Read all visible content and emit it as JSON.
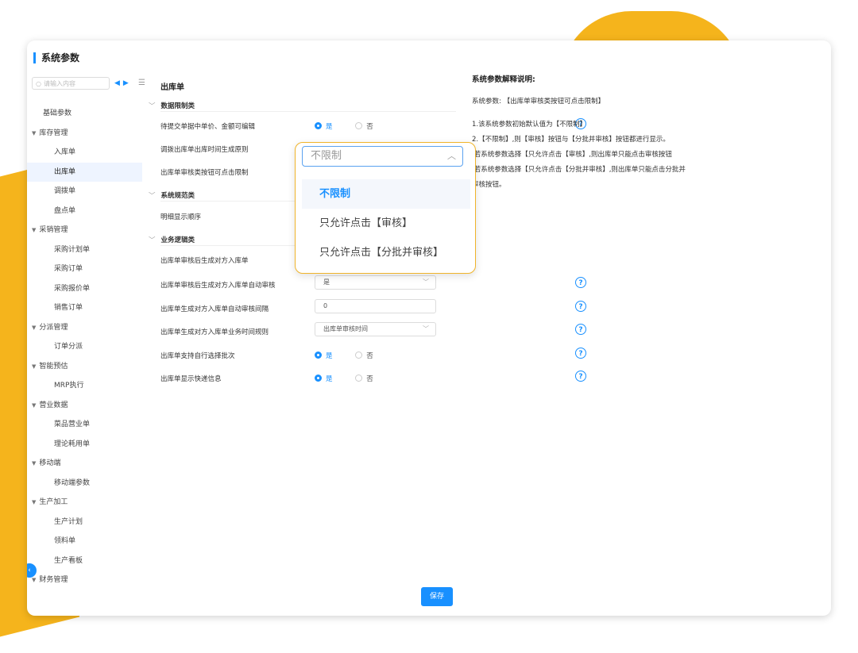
{
  "page": {
    "title": "系统参数"
  },
  "search": {
    "placeholder": "请输入内容"
  },
  "sidebar": [
    {
      "label": "基础参数",
      "type": "top"
    },
    {
      "label": "库存管理",
      "type": "group"
    },
    {
      "label": "入库单",
      "type": "child"
    },
    {
      "label": "出库单",
      "type": "child",
      "active": true
    },
    {
      "label": "调拨单",
      "type": "child"
    },
    {
      "label": "盘点单",
      "type": "child"
    },
    {
      "label": "采销管理",
      "type": "group"
    },
    {
      "label": "采购计划单",
      "type": "child"
    },
    {
      "label": "采购订单",
      "type": "child"
    },
    {
      "label": "采购报价单",
      "type": "child"
    },
    {
      "label": "销售订单",
      "type": "child"
    },
    {
      "label": "分派管理",
      "type": "group"
    },
    {
      "label": "订单分派",
      "type": "child"
    },
    {
      "label": "智能预估",
      "type": "group"
    },
    {
      "label": "MRP执行",
      "type": "child"
    },
    {
      "label": "营业数据",
      "type": "group"
    },
    {
      "label": "菜品营业单",
      "type": "child"
    },
    {
      "label": "理论耗用单",
      "type": "child"
    },
    {
      "label": "移动端",
      "type": "group"
    },
    {
      "label": "移动端参数",
      "type": "child"
    },
    {
      "label": "生产加工",
      "type": "group"
    },
    {
      "label": "生产计划",
      "type": "child"
    },
    {
      "label": "领料单",
      "type": "child"
    },
    {
      "label": "生产看板",
      "type": "child"
    },
    {
      "label": "财务管理",
      "type": "group"
    }
  ],
  "main": {
    "section_title": "出库单",
    "categories": {
      "data_limit": "数据限制类",
      "system_norm": "系统规范类",
      "business_logic": "业务逻辑类"
    },
    "rows": {
      "r1": {
        "label": "待提交单据中单价、金额可编辑",
        "yes": "是",
        "no": "否"
      },
      "r2": {
        "label": "调拨出库单出库时间生成原则"
      },
      "r3": {
        "label": "出库单审核类按钮可点击限制"
      },
      "r4": {
        "label": "明细显示顺序"
      },
      "r5": {
        "label": "出库单审核后生成对方入库单"
      },
      "r6": {
        "label": "出库单审核后生成对方入库单自动审核",
        "value": "是"
      },
      "r7": {
        "label": "出库单生成对方入库单自动审核间隔",
        "value": "0"
      },
      "r8": {
        "label": "出库单生成对方入库单业务时间规则",
        "value": "出库单审核时间"
      },
      "r9": {
        "label": "出库单支持自行选择批次",
        "yes": "是",
        "no": "否"
      },
      "r10": {
        "label": "出库单显示快递信息",
        "yes": "是",
        "no": "否"
      }
    },
    "help_glyph": "?",
    "save_label": "保存"
  },
  "explain": {
    "title": "系统参数解释说明:",
    "param": "系统参数: 【出库单审核类按钮可点击限制】",
    "lines": [
      "1.该系统参数初始默认值为【不限制】",
      "2.【不限制】,则【审核】按钮与【分批并审核】按钮都进行显示。",
      ".若系统参数选择【只允许点击【审核】,则出库单只能点击审核按钮",
      ".若系统参数选择【只允许点击【分批并审核】,则出库单只能点击分批并",
      "审核按钮。"
    ]
  },
  "dropdown": {
    "current": "不限制",
    "options": [
      "不限制",
      "只允许点击【审核】",
      "只允许点击【分批并审核】"
    ]
  }
}
